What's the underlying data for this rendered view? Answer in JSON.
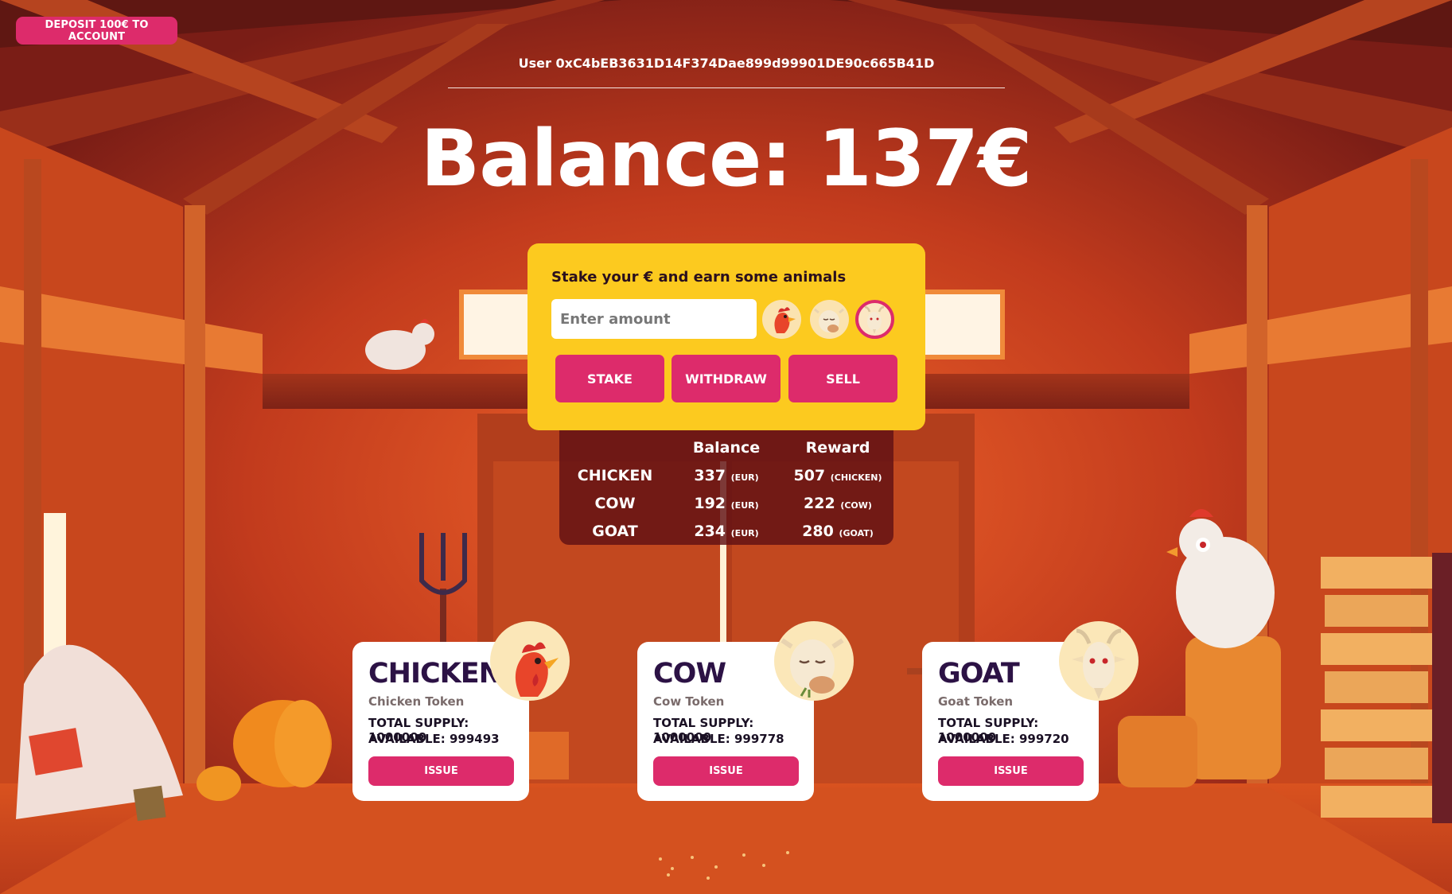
{
  "header": {
    "deposit_label": "DEPOSIT 100€ TO ACCOUNT",
    "user_label": "User 0xC4bEB3631D14F374Dae899d99901DE90c665B41D",
    "balance_label": "Balance: 137€"
  },
  "stake": {
    "title": "Stake your € and earn some animals",
    "amount_placeholder": "Enter amount",
    "animals": [
      {
        "name": "chicken",
        "icon": "chicken-icon",
        "selected": false
      },
      {
        "name": "cow",
        "icon": "cow-icon",
        "selected": false
      },
      {
        "name": "goat",
        "icon": "goat-icon",
        "selected": true
      }
    ],
    "stake_label": "STAKE",
    "withdraw_label": "WITHDRAW",
    "sell_label": "SELL"
  },
  "balances": {
    "headers": {
      "balance": "Balance",
      "reward": "Reward"
    },
    "rows": [
      {
        "name": "CHICKEN",
        "balance": "337",
        "balance_unit": "(EUR)",
        "reward": "507",
        "reward_unit": "(CHICKEN)"
      },
      {
        "name": "COW",
        "balance": "192",
        "balance_unit": "(EUR)",
        "reward": "222",
        "reward_unit": "(COW)"
      },
      {
        "name": "GOAT",
        "balance": "234",
        "balance_unit": "(EUR)",
        "reward": "280",
        "reward_unit": "(GOAT)"
      }
    ]
  },
  "cards": [
    {
      "name": "CHICKEN",
      "subtitle": "Chicken Token",
      "supply": "TOTAL SUPPLY: 1000000",
      "available": "AVAILABLE: 999493",
      "issue_label": "ISSUE",
      "icon": "chicken-icon"
    },
    {
      "name": "COW",
      "subtitle": "Cow Token",
      "supply": "TOTAL SUPPLY: 1000000",
      "available": "AVAILABLE: 999778",
      "issue_label": "ISSUE",
      "icon": "cow-icon"
    },
    {
      "name": "GOAT",
      "subtitle": "Goat Token",
      "supply": "TOTAL SUPPLY: 1000000",
      "available": "AVAILABLE: 999720",
      "issue_label": "ISSUE",
      "icon": "goat-icon"
    }
  ],
  "colors": {
    "accent": "#dd2b6b",
    "panel": "#fcca1f",
    "barn_dark": "#8a2a18",
    "barn_light": "#e0561e"
  }
}
